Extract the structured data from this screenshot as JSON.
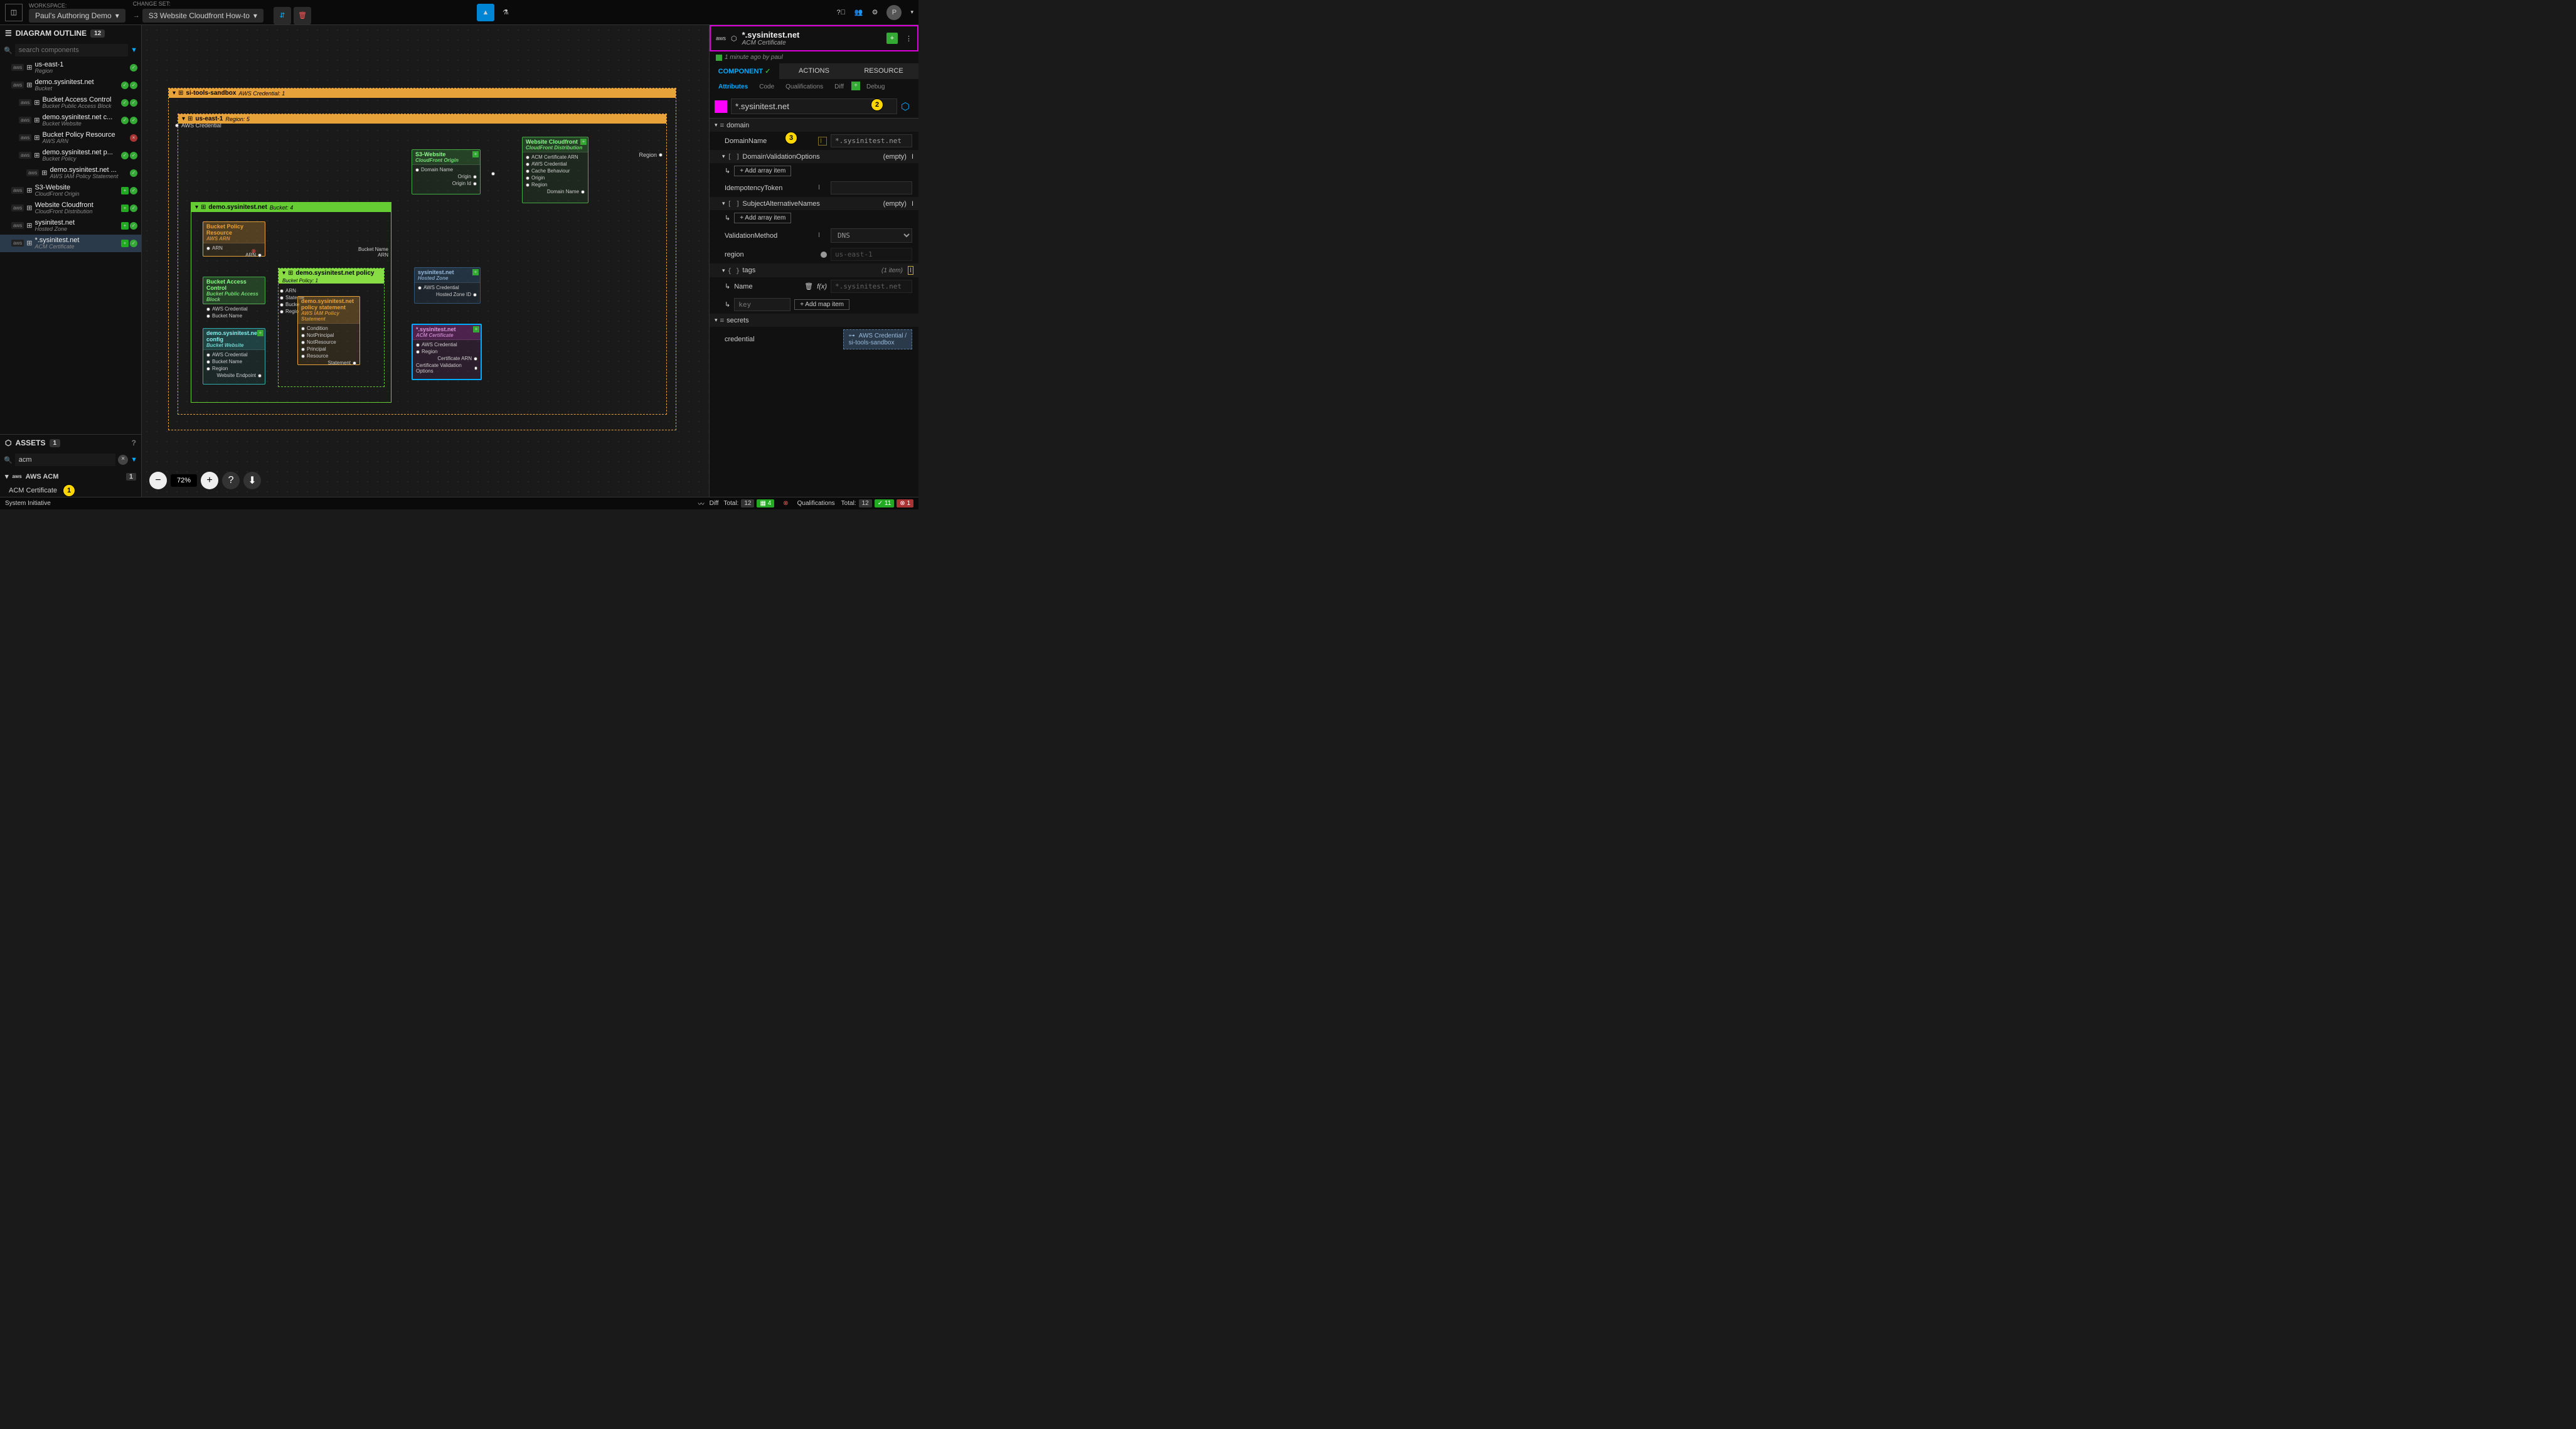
{
  "topbar": {
    "workspace_label": "WORKSPACE:",
    "workspace_value": "Paul's Authoring Demo",
    "changeset_label": "CHANGE SET:",
    "changeset_value": "S3 Website Cloudfront How-to"
  },
  "outline": {
    "title": "DIAGRAM OUTLINE",
    "count": "12",
    "search_placeholder": "search components",
    "items": [
      {
        "title": "us-east-1",
        "sub": "Region",
        "indent": 1,
        "status": [
          "chk"
        ]
      },
      {
        "title": "demo.sysinitest.net",
        "sub": "Bucket",
        "indent": 1,
        "status": [
          "chk",
          "chk"
        ]
      },
      {
        "title": "Bucket Access Control",
        "sub": "Bucket Public Access Block",
        "indent": 2,
        "status": [
          "chk",
          "chk"
        ]
      },
      {
        "title": "demo.sysinitest.net c...",
        "sub": "Bucket Website",
        "indent": 2,
        "status": [
          "chk",
          "chk"
        ]
      },
      {
        "title": "Bucket Policy Resource",
        "sub": "AWS ARN",
        "indent": 2,
        "status": [
          "red"
        ]
      },
      {
        "title": "demo.sysinitest.net p...",
        "sub": "Bucket Policy",
        "indent": 2,
        "status": [
          "chk",
          "chk"
        ]
      },
      {
        "title": "demo.sysinitest.net ...",
        "sub": "AWS IAM Policy Statement",
        "indent": 3,
        "status": [
          "chk"
        ]
      },
      {
        "title": "S3-Website",
        "sub": "CloudFront Origin",
        "indent": 1,
        "status": [
          "plus",
          "chk"
        ]
      },
      {
        "title": "Website Cloudfront",
        "sub": "CloudFront Distribution",
        "indent": 1,
        "status": [
          "plus",
          "chk"
        ]
      },
      {
        "title": "sysinitest.net",
        "sub": "Hosted Zone",
        "indent": 1,
        "status": [
          "plus",
          "chk"
        ]
      },
      {
        "title": "*.sysinitest.net",
        "sub": "ACM Certificate",
        "indent": 1,
        "status": [
          "plus",
          "chk"
        ],
        "selected": true
      }
    ]
  },
  "assets": {
    "title": "ASSETS",
    "count": "1",
    "search_value": "acm",
    "group": "AWS ACM",
    "group_count": "1",
    "item": "ACM Certificate"
  },
  "canvas": {
    "zoom": "72%",
    "frames": {
      "credential": {
        "title": "si-tools-sandbox",
        "sub": "AWS Credential: 1"
      },
      "region": {
        "title": "us-east-1",
        "sub": "Region: 5"
      },
      "bucket": {
        "title": "demo.sysinitest.net",
        "sub": "Bucket: 4"
      },
      "policy": {
        "title": "demo.sysinitest.net policy",
        "sub": "Bucket Policy: 1"
      }
    },
    "nodes": {
      "aws_credential_port": "AWS Credential",
      "region_port": "Region",
      "bpr": {
        "title": "Bucket Policy Resource",
        "sub": "AWS ARN",
        "ports": [
          "ARN",
          "ARN"
        ]
      },
      "bac": {
        "title": "Bucket Access Control",
        "sub": "Bucket Public Access Block",
        "ports": [
          "AWS Credential",
          "Bucket Name"
        ]
      },
      "cfg": {
        "title": "demo.sysinitest.net config",
        "sub": "Bucket Website",
        "ports": [
          "AWS Credential",
          "Bucket Name",
          "Region",
          "Website Endpoint"
        ]
      },
      "pstmt": {
        "title": "demo.sysinitest.net policy statement",
        "sub": "AWS IAM Policy Statement",
        "ports": [
          "Condition",
          "NotPrincipal",
          "NotResource",
          "Principal",
          "Resource",
          "Statement"
        ],
        "left": [
          "ARN",
          "Stateme",
          "Bucke",
          "Regio"
        ]
      },
      "bucket_ports": [
        "Bucket Name",
        "ARN"
      ],
      "s3w": {
        "title": "S3-Website",
        "sub": "CloudFront Origin",
        "ports": [
          "Domain Name",
          "Origin",
          "Origin Id"
        ]
      },
      "wcf": {
        "title": "Website Cloudfront",
        "sub": "CloudFront Distribution",
        "ports": [
          "ACM Certificate ARN",
          "AWS Credential",
          "Cache Behaviour",
          "Origin",
          "Region",
          "Domain Name"
        ]
      },
      "hz": {
        "title": "sysinitest.net",
        "sub": "Hosted Zone",
        "ports": [
          "AWS Credential",
          "Hosted Zone ID"
        ]
      },
      "acm": {
        "title": "*.sysinitest.net",
        "sub": "ACM Certificate",
        "ports": [
          "AWS Credential",
          "Region",
          "Certificate ARN",
          "Certificate Validation Options"
        ]
      }
    }
  },
  "right": {
    "title": "*.sysinitest.net",
    "sub": "ACM Certificate",
    "meta": "1 minute ago by paul",
    "tabs_main": [
      "COMPONENT",
      "ACTIONS",
      "RESOURCE"
    ],
    "tabs_sub": [
      "Attributes",
      "Code",
      "Qualifications",
      "Diff",
      "Debug"
    ],
    "name_value": "*.sysinitest.net",
    "sections": {
      "domain": "domain",
      "domain_name_label": "DomainName",
      "domain_name_value": "*.sysinitest.net",
      "dvo_label": "DomainValidationOptions",
      "empty": "(empty)",
      "add_array": "Add array item",
      "idem_label": "IdempotencyToken",
      "san_label": "SubjectAlternativeNames",
      "vm_label": "ValidationMethod",
      "vm_value": "DNS",
      "region_label": "region",
      "region_value": "us-east-1",
      "tags_label": "tags",
      "tags_count": "(1 item)",
      "name_key": "Name",
      "name_val": "*.sysinitest.net",
      "key_placeholder": "key",
      "add_map": "Add map item",
      "secrets": "secrets",
      "cred_label": "credential",
      "cred_val1": "AWS Credential /",
      "cred_val2": "si-tools-sandbox"
    }
  },
  "statusbar": {
    "brand": "System Initiative",
    "diff": "Diff",
    "total_label": "Total:",
    "total": "12",
    "added": "4",
    "qual": "Qualifications",
    "q_total": "12",
    "q_pass": "11",
    "q_fail": "1"
  },
  "callouts": {
    "c1": "1",
    "c2": "2",
    "c3": "3"
  }
}
